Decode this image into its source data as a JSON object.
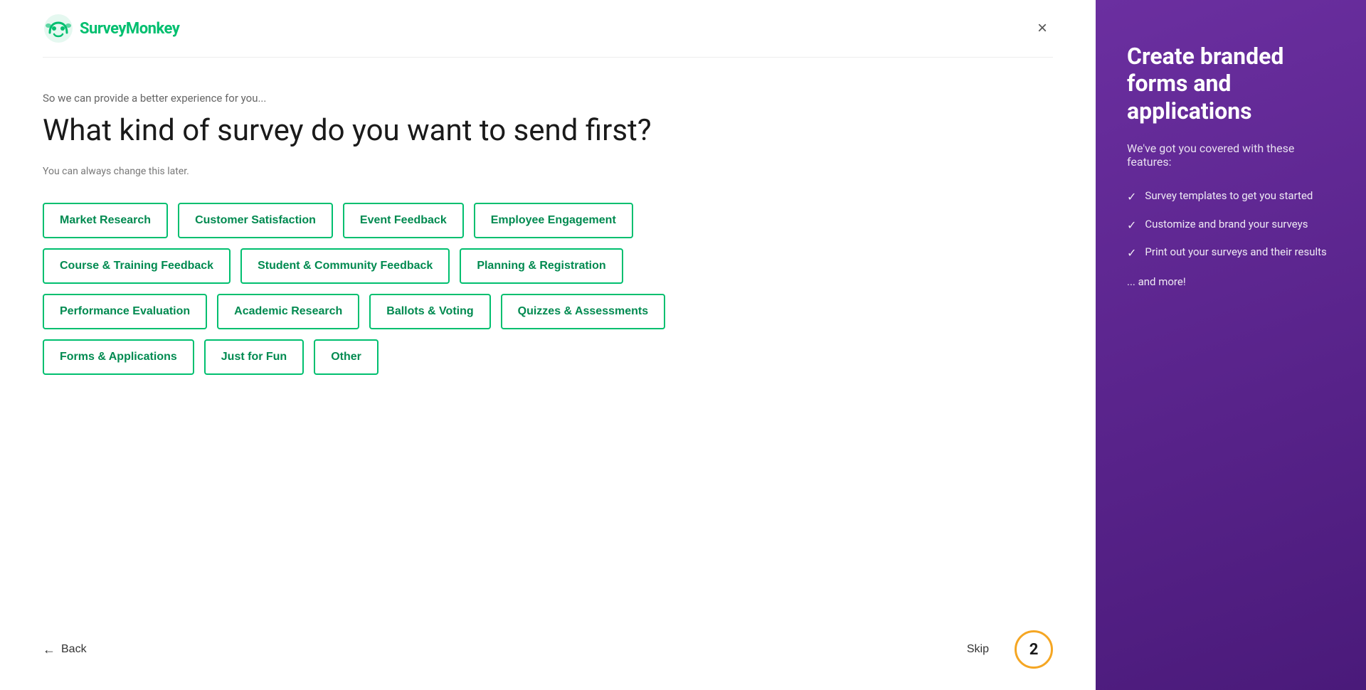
{
  "header": {
    "logo_text": "SurveyMonkey",
    "close_label": "×"
  },
  "content": {
    "subtitle": "So we can provide a better experience for you...",
    "main_title": "What kind of survey do you want to send first?",
    "helper_text": "You can always change this later.",
    "categories": [
      [
        "Market Research",
        "Customer Satisfaction",
        "Event Feedback",
        "Employee Engagement"
      ],
      [
        "Course & Training Feedback",
        "Student & Community Feedback",
        "Planning & Registration"
      ],
      [
        "Performance Evaluation",
        "Academic Research",
        "Ballots & Voting",
        "Quizzes & Assessments"
      ],
      [
        "Forms & Applications",
        "Just for Fun",
        "Other"
      ]
    ]
  },
  "footer": {
    "back_label": "Back",
    "skip_label": "Skip",
    "step_number": "2"
  },
  "sidebar": {
    "title": "Create branded forms and applications",
    "subtitle": "We've got you covered with these features:",
    "features": [
      "Survey templates to get you started",
      "Customize and brand your surveys",
      "Print out your surveys and their results"
    ],
    "more": "... and more!"
  }
}
